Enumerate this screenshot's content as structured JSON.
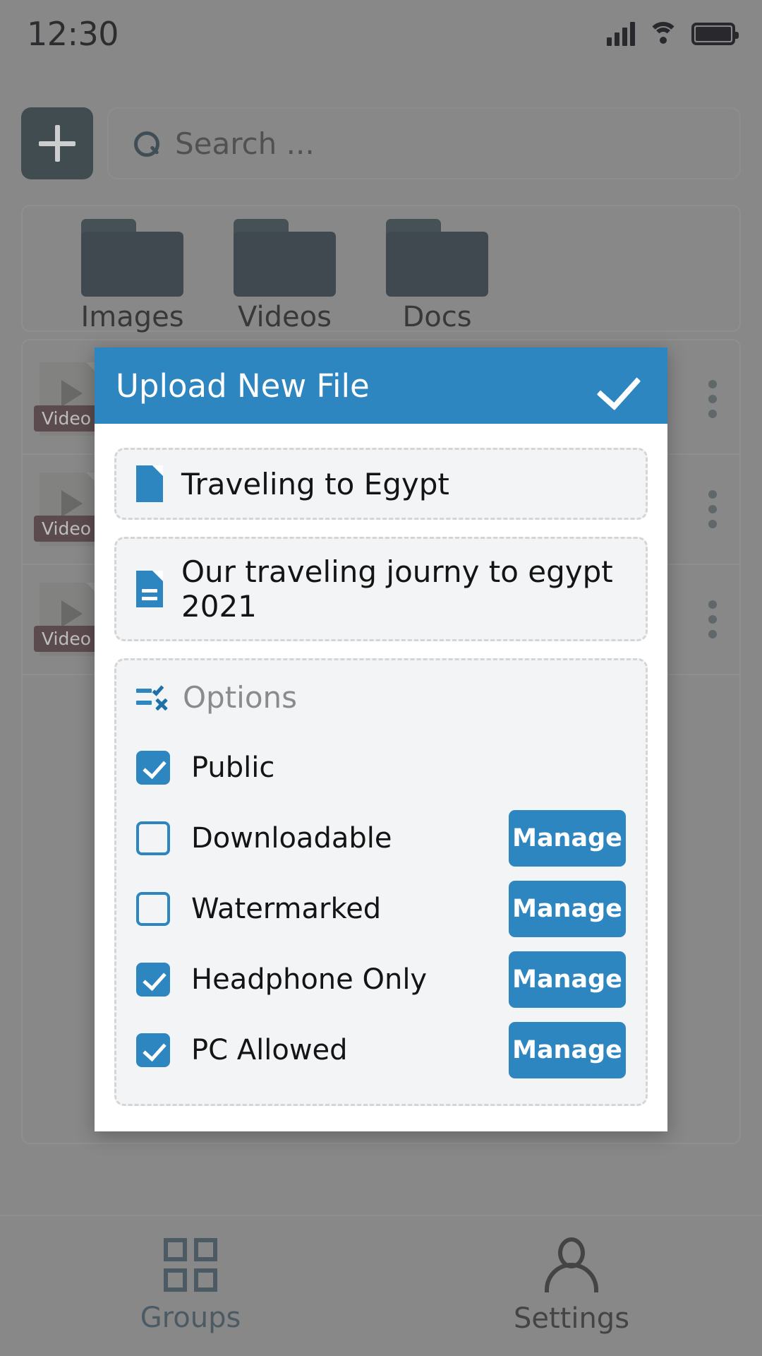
{
  "status_bar": {
    "time": "12:30",
    "icons": [
      "signal-icon",
      "wifi-icon",
      "battery-icon"
    ]
  },
  "background_app": {
    "add_button_label": "+",
    "search": {
      "placeholder": "Search ...",
      "value": "",
      "icon": "search-icon"
    },
    "folders": [
      {
        "label": "Images",
        "icon": "folder-icon"
      },
      {
        "label": "Videos",
        "icon": "folder-icon"
      },
      {
        "label": "Docs",
        "icon": "folder-icon"
      }
    ],
    "file_rows": [
      {
        "badge": "Video",
        "icon": "video-thumbnail-icon",
        "menu": "kebab-menu-icon"
      },
      {
        "badge": "Video",
        "icon": "video-thumbnail-icon",
        "menu": "kebab-menu-icon"
      },
      {
        "badge": "Video",
        "icon": "video-thumbnail-icon",
        "menu": "kebab-menu-icon"
      }
    ],
    "bottom_nav": [
      {
        "label": "Groups",
        "icon": "grid-icon",
        "active": true
      },
      {
        "label": "Settings",
        "icon": "person-icon",
        "active": false
      }
    ]
  },
  "modal": {
    "title": "Upload New File",
    "confirm_icon": "check-icon",
    "fields": [
      {
        "value": "Traveling to Egypt",
        "icon": "file-icon"
      },
      {
        "value": "Our traveling journy to egypt 2021",
        "icon": "document-lines-icon"
      }
    ],
    "options_section": {
      "title": "Options",
      "icon": "tasks-checklist-icon",
      "items": [
        {
          "label": "Public",
          "checked": true,
          "has_manage": false,
          "manage_label": "Manage"
        },
        {
          "label": "Downloadable",
          "checked": false,
          "has_manage": true,
          "manage_label": "Manage"
        },
        {
          "label": "Watermarked",
          "checked": false,
          "has_manage": true,
          "manage_label": "Manage"
        },
        {
          "label": "Headphone Only",
          "checked": true,
          "has_manage": true,
          "manage_label": "Manage"
        },
        {
          "label": "PC Allowed",
          "checked": true,
          "has_manage": true,
          "manage_label": "Manage"
        }
      ]
    }
  },
  "colors": {
    "accent_blue": "#2e86c1",
    "dark_blue": "#15476a",
    "badge_red": "#8d3347",
    "scrim_gray": "#888888"
  }
}
